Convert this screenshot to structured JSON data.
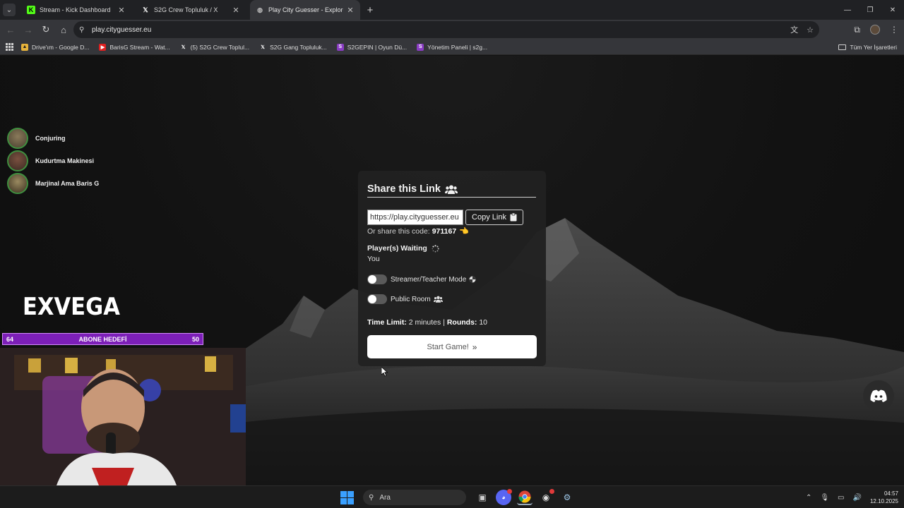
{
  "browser": {
    "tabs": [
      {
        "title": "Stream - Kick Dashboard",
        "icon": "kick-icon",
        "active": false
      },
      {
        "title": "S2G Crew Topluluk / X",
        "icon": "x-icon",
        "active": false
      },
      {
        "title": "Play City Guesser - Explore the",
        "icon": "globe-icon",
        "active": true
      }
    ],
    "url": "play.cityguesser.eu",
    "bookmarks": [
      {
        "label": "Drive'ım - Google D...",
        "icon": "drive-icon"
      },
      {
        "label": "BarisG Stream - Wat...",
        "icon": "youtube-icon"
      },
      {
        "label": "(5) S2G Crew Toplul...",
        "icon": "x-icon"
      },
      {
        "label": "S2G Gang Topluluk...",
        "icon": "x-icon"
      },
      {
        "label": "S2GEPIN | Oyun Dü...",
        "icon": "twitch-icon"
      },
      {
        "label": "Yönetim Paneli | s2g...",
        "icon": "twitch-icon"
      }
    ],
    "all_bookmarks": "Tüm Yer İşaretleri"
  },
  "overlay": {
    "viewers": [
      {
        "name": "Conjuring"
      },
      {
        "name": "Kudurtma Makinesi"
      },
      {
        "name": "Marjinal Ama Baris G"
      }
    ],
    "brand": "EXVEGA",
    "sub_goal": {
      "current": "64",
      "title": "ABONE HEDEFİ",
      "target": "50"
    }
  },
  "modal": {
    "title": "Share this Link",
    "link_value": "https://play.cityguesser.eu",
    "copy_label": "Copy Link",
    "share_code_prefix": "Or share this code:",
    "share_code": "971167",
    "waiting_label": "Player(s) Waiting",
    "players": [
      "You"
    ],
    "streamer_mode_label": "Streamer/Teacher Mode",
    "streamer_mode_on": false,
    "public_room_label": "Public Room",
    "public_room_on": false,
    "time_limit_label": "Time Limit:",
    "time_limit_value": "2 minutes",
    "separator": "|",
    "rounds_label": "Rounds:",
    "rounds_value": "10",
    "start_label": "Start Game!"
  },
  "taskbar": {
    "search_placeholder": "Ara",
    "time": "04:57",
    "date": "12.10.2025"
  },
  "colors": {
    "sub_goal_bg": "#7d1fb8",
    "kick_green": "#53fc18",
    "windows_blue": "#3aa0ff"
  }
}
